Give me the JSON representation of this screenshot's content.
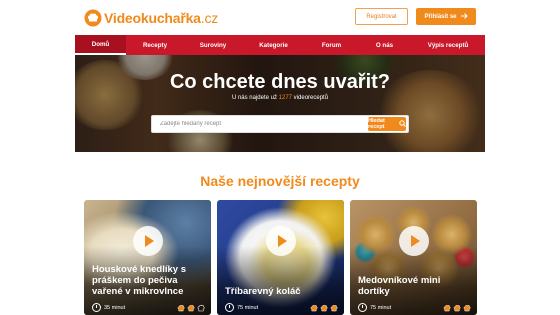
{
  "header": {
    "logo": {
      "part1": "Video",
      "part2": "kuchařka",
      "part3": ".cz"
    },
    "register_label": "Registrovat",
    "login_label": "Přihlásit se"
  },
  "nav": {
    "items": [
      {
        "label": "Domů",
        "active": true
      },
      {
        "label": "Recepty"
      },
      {
        "label": "Suroviny"
      },
      {
        "label": "Kategorie"
      },
      {
        "label": "Forum"
      },
      {
        "label": "O nás"
      },
      {
        "label": "Výpis receptů"
      }
    ]
  },
  "hero": {
    "title": "Co chcete dnes uvařit?",
    "subtitle_before": "U nás najdete už ",
    "recipe_count": "1277",
    "subtitle_after": " videoreceptů",
    "search_placeholder": "Zadejte hledaný recept",
    "search_button": "Hledat recept"
  },
  "section": {
    "title": "Naše nejnovější recepty"
  },
  "cards": [
    {
      "title": "Houskové knedlíky s práškem do pečiva vařené v mikrovlnce",
      "time": "35 minut",
      "difficulty": 2
    },
    {
      "title": "Tříbarevný koláč",
      "time": "75 minut",
      "difficulty": 3
    },
    {
      "title": "Medovníkové mini dortíky",
      "time": "75 minut",
      "difficulty": 3
    }
  ],
  "colors": {
    "accent": "#f08a1c",
    "nav": "#c8182a",
    "nav_active": "#a9101f"
  },
  "icons": {
    "logo": "chef-hat-icon",
    "login_arrow": "arrow-right-icon",
    "search": "search-icon",
    "play": "play-icon",
    "time": "clock-icon",
    "difficulty": "chef-hat-icon"
  }
}
